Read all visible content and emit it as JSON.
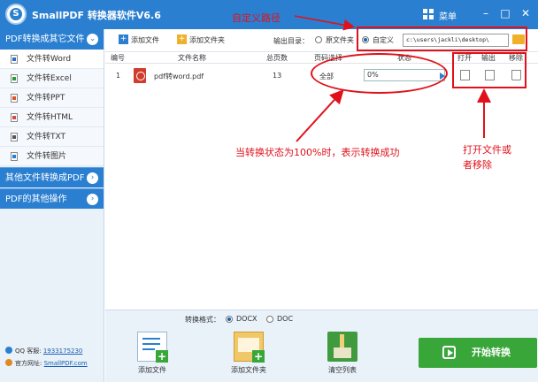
{
  "titlebar": {
    "app_title": "SmallPDF 转换器软件V6.6",
    "menu_label": "菜单",
    "minimize": "–",
    "maximize": "□",
    "close": "✕"
  },
  "sidebar": {
    "section1": "PDF转换成其它文件",
    "items": [
      {
        "label": "文件转Word",
        "icon_color": "#2b6cd1"
      },
      {
        "label": "文件转Excel",
        "icon_color": "#2a9b3a"
      },
      {
        "label": "文件转PPT",
        "icon_color": "#d9532b"
      },
      {
        "label": "文件转HTML",
        "icon_color": "#d04a4a"
      },
      {
        "label": "文件转TXT",
        "icon_color": "#555555"
      },
      {
        "label": "文件转图片",
        "icon_color": "#2b7fd0"
      }
    ],
    "section2": "其他文件转换成PDF",
    "section3": "PDF的其他操作",
    "qq_label": "QQ 客服:",
    "qq_number": "1933175230",
    "site_label": "官方网址:",
    "site_url": "SmallPDF.com"
  },
  "toolbar": {
    "add_file": "添加文件",
    "add_folder": "添加文件夹",
    "output_label": "输出目录：",
    "original_folder": "原文件夹",
    "custom": "自定义",
    "output_path": "c:\\users\\jackli\\desktop\\"
  },
  "table": {
    "headers": [
      "编号",
      "文件名称",
      "总页数",
      "页码选择",
      "状态",
      "打开",
      "输出",
      "移除"
    ],
    "rows": [
      {
        "index": "1",
        "filename": "pdf转word.pdf",
        "pages": "13",
        "page_select": "全部",
        "status": "0%"
      }
    ]
  },
  "format": {
    "label": "转换格式：",
    "docx": "DOCX",
    "doc": "DOC",
    "selected": "DOCX"
  },
  "bottom": {
    "add_file": "添加文件",
    "add_folder": "添加文件夹",
    "clear_list": "清空列表",
    "start": "开始转换"
  },
  "annotations": {
    "custom_path": "自定义路径",
    "status_note": "当转换状态为100%时，表示转换成功",
    "open_remove_note_line1": "打开文件或",
    "open_remove_note_line2": "者移除"
  },
  "colors": {
    "brand_blue": "#2b7fd0",
    "start_green": "#39a63a",
    "annotation_red": "#e0111b"
  }
}
